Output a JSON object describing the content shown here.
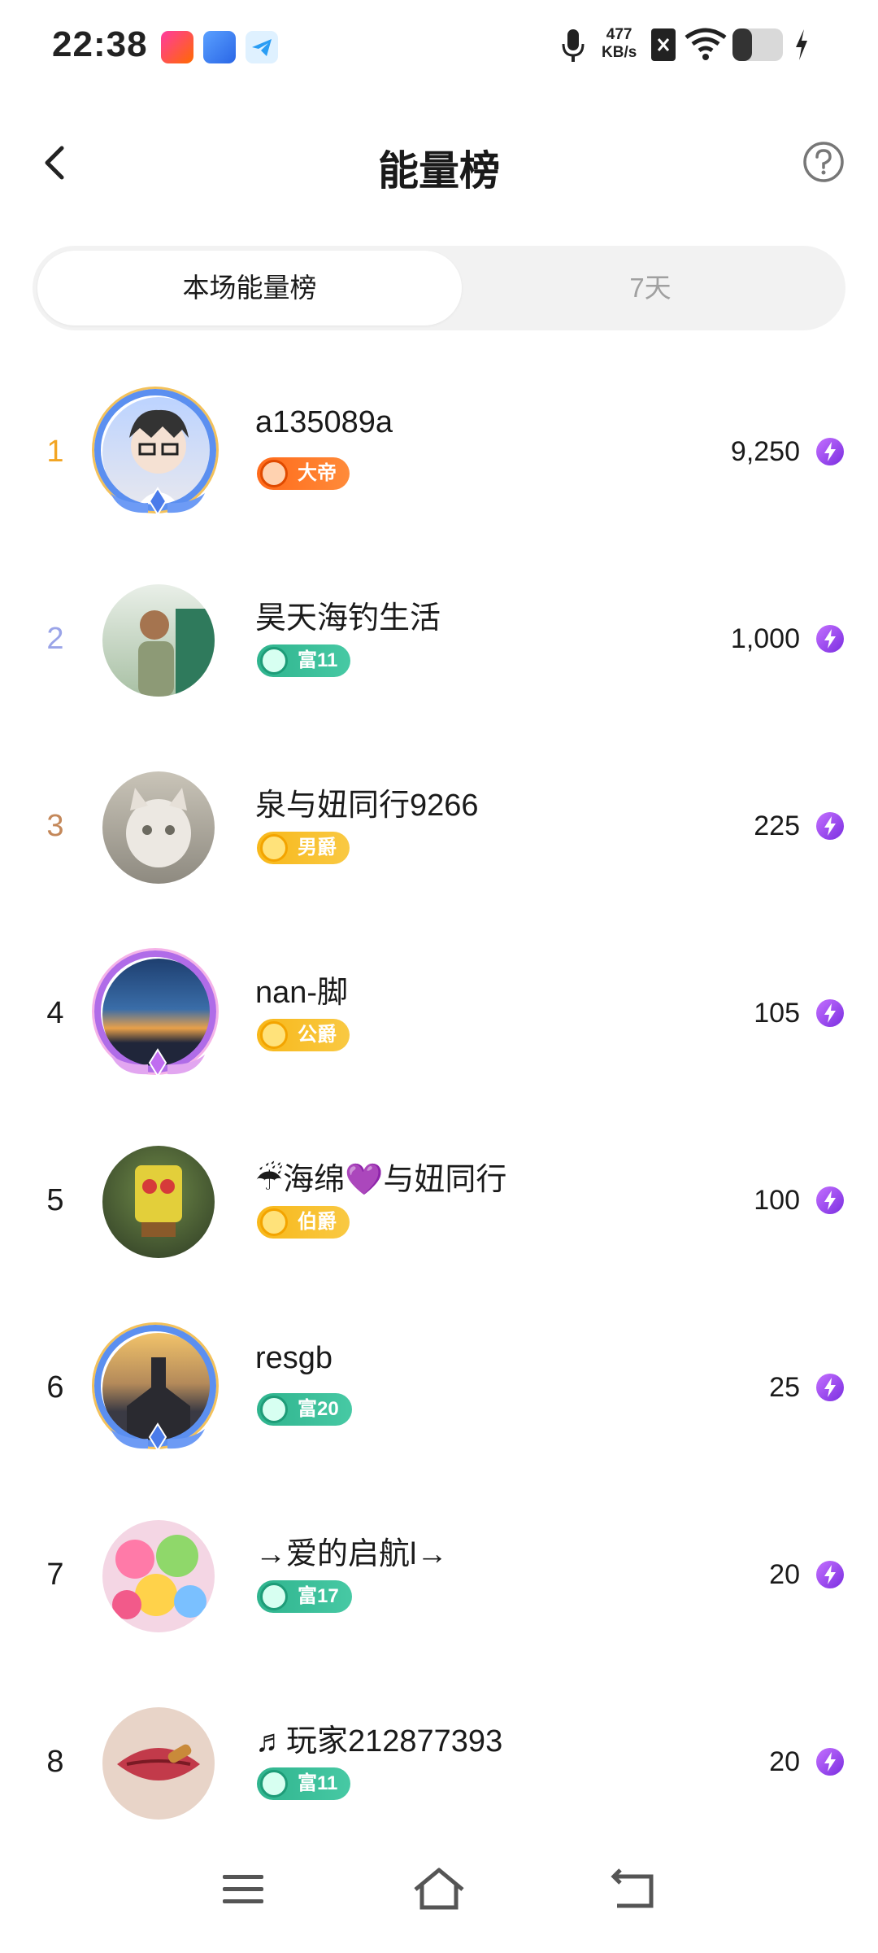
{
  "status_bar": {
    "time": "22:38",
    "net_speed": "477",
    "net_unit": "KB/s",
    "icons": [
      "mic-icon",
      "nfc-icon",
      "wifi-icon",
      "battery-icon",
      "charging-icon"
    ]
  },
  "header": {
    "title": "能量榜"
  },
  "tabs": {
    "active": "本场能量榜",
    "inactive": "7天"
  },
  "colors": {
    "rank1": "#f2a524",
    "rank2": "#9aa4e8",
    "rank3": "#c4885a",
    "rank_default": "#1a1a1a"
  },
  "rows": [
    {
      "rank": "1",
      "name": "a135089a",
      "badge": "大帝",
      "badge_style": "orange",
      "score": "9,250"
    },
    {
      "rank": "2",
      "name": "昊天海钓生活",
      "badge": "富11",
      "badge_style": "green",
      "score": "1,000"
    },
    {
      "rank": "3",
      "name": "泉与妞同行9266",
      "badge": "男爵",
      "badge_style": "gold",
      "score": "225"
    },
    {
      "rank": "4",
      "name": "nan-脚",
      "badge": "公爵",
      "badge_style": "gold",
      "score": "105"
    },
    {
      "rank": "5",
      "name": "☔海绵💜与妞同行",
      "badge": "伯爵",
      "badge_style": "gold",
      "score": "100"
    },
    {
      "rank": "6",
      "name": "resgb",
      "badge": "富20",
      "badge_style": "green",
      "score": "25"
    },
    {
      "rank": "7",
      "name": "→爱的启航l→",
      "badge": "富17",
      "badge_style": "green",
      "score": "20"
    },
    {
      "rank": "8",
      "name": "♬玩家212877393",
      "badge": "富11",
      "badge_style": "green",
      "score": "20"
    }
  ]
}
